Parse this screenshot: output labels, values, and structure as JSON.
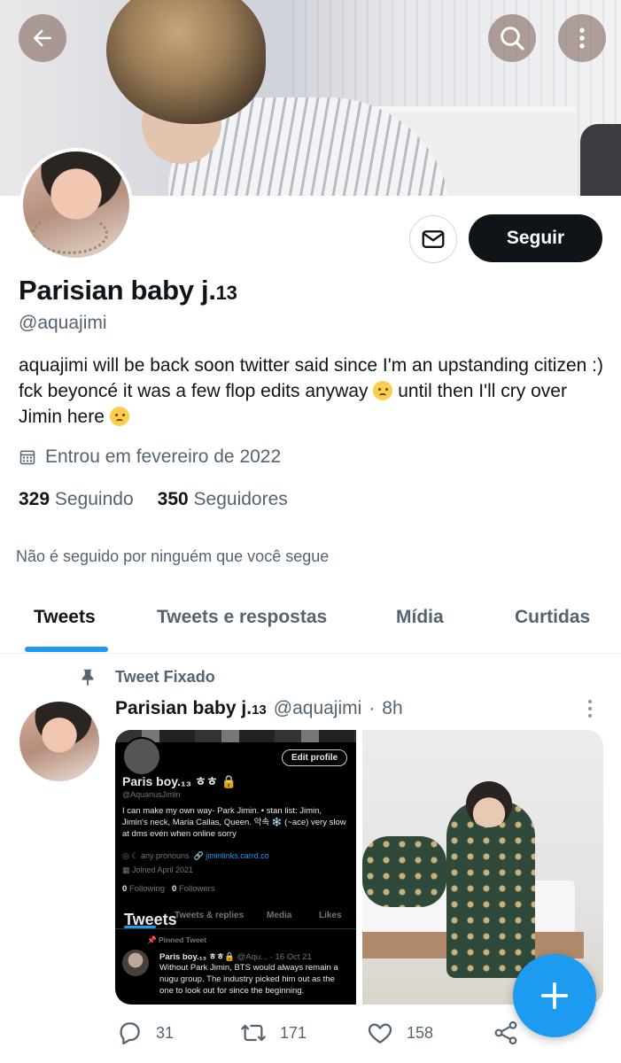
{
  "profile": {
    "display_name": "Parisian baby j.",
    "name_suffix": "13",
    "handle": "@aquajimi",
    "bio_part1": "aquajimi will be back soon twitter said since I'm an upstanding citizen :) fck beyoncé it was a few flop edits anyway ",
    "bio_part2": " until then I'll cry over Jimin here ",
    "joined": "Entrou em fevereiro de 2022",
    "following_count": "329",
    "following_label": "Seguindo",
    "followers_count": "350",
    "followers_label": "Seguidores",
    "not_followed": "Não é seguido por ninguém que você segue"
  },
  "header": {
    "follow_label": "Seguir"
  },
  "tabs": [
    {
      "label": "Tweets",
      "active": true
    },
    {
      "label": "Tweets e respostas",
      "active": false
    },
    {
      "label": "Mídia",
      "active": false
    },
    {
      "label": "Curtidas",
      "active": false
    }
  ],
  "tweet": {
    "pinned_label": "Tweet Fixado",
    "author_name": "Parisian baby j.",
    "author_suffix": "13",
    "author_handle": "@aquajimi",
    "separator": "·",
    "time": "8h",
    "replies": "31",
    "retweets": "171",
    "likes": "158"
  },
  "embedded_screenshot": {
    "edit_profile": "Edit profile",
    "name": "Paris boy.₁₃ ㅎㅎ 🔒",
    "handle": "@AquariusJimin",
    "bio": "I can make my own way- Park Jimin. • stan list: Jimin, Jimin's neck, Maria Callas, Queen. 악속 ❄️ (~ace) very slow at dms even when online sorry",
    "pronouns": "any pronouns",
    "link": "jiminlinks.carrd.co",
    "joined": "Joined April 2021",
    "following_num": "0",
    "following_label": "Following",
    "followers_num": "0",
    "followers_label": "Followers",
    "tab1": "Tweets",
    "tab2": "Tweets & replies",
    "tab3": "Media",
    "tab4": "Likes",
    "pinned": "Pinned Tweet",
    "tweet_name": "Paris boy.₁₃ ㅎㅎ🔒",
    "tweet_handle": "@Aqu...",
    "tweet_date": "· 16 Oct 21",
    "tweet_text": "Without Park Jimin, BTS would always remain a nugu group. The industry picked him out as the one to look out for since the beginning."
  },
  "colors": {
    "accent": "#1d9bf0",
    "text": "#0f1419",
    "muted": "#536471"
  }
}
